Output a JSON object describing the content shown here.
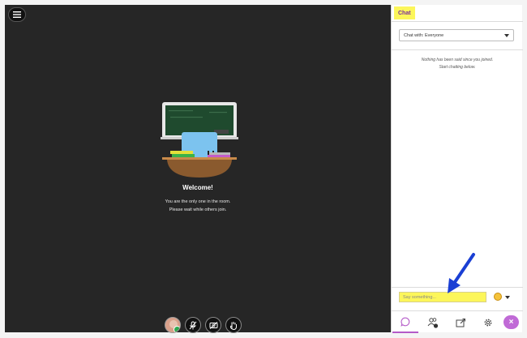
{
  "session": {
    "welcome_title": "Welcome!",
    "welcome_line1": "You are the only one in the room.",
    "welcome_line2": "Please wait while others join."
  },
  "panel": {
    "tab_label": "Chat",
    "chat_with": "Chat with: Everyone",
    "empty_line1": "Nothing has been said since you joined.",
    "empty_line2": "Start chatting below.",
    "input_placeholder": "Say something...",
    "close_glyph": "×"
  },
  "icons": {
    "menu": "hamburger-menu-icon",
    "mic": "microphone-muted-icon",
    "camera": "camera-off-icon",
    "hand": "raise-hand-icon",
    "chat": "chat-bubble-icon",
    "attendees": "attendees-icon",
    "share": "share-content-icon",
    "settings": "gear-icon",
    "emoji": "emoji-icon",
    "close": "close-icon"
  },
  "colors": {
    "stage_bg": "#262626",
    "highlight": "#fcf65a",
    "accent_purple": "#b45ac8",
    "annotation_arrow": "#1a3fd4"
  }
}
